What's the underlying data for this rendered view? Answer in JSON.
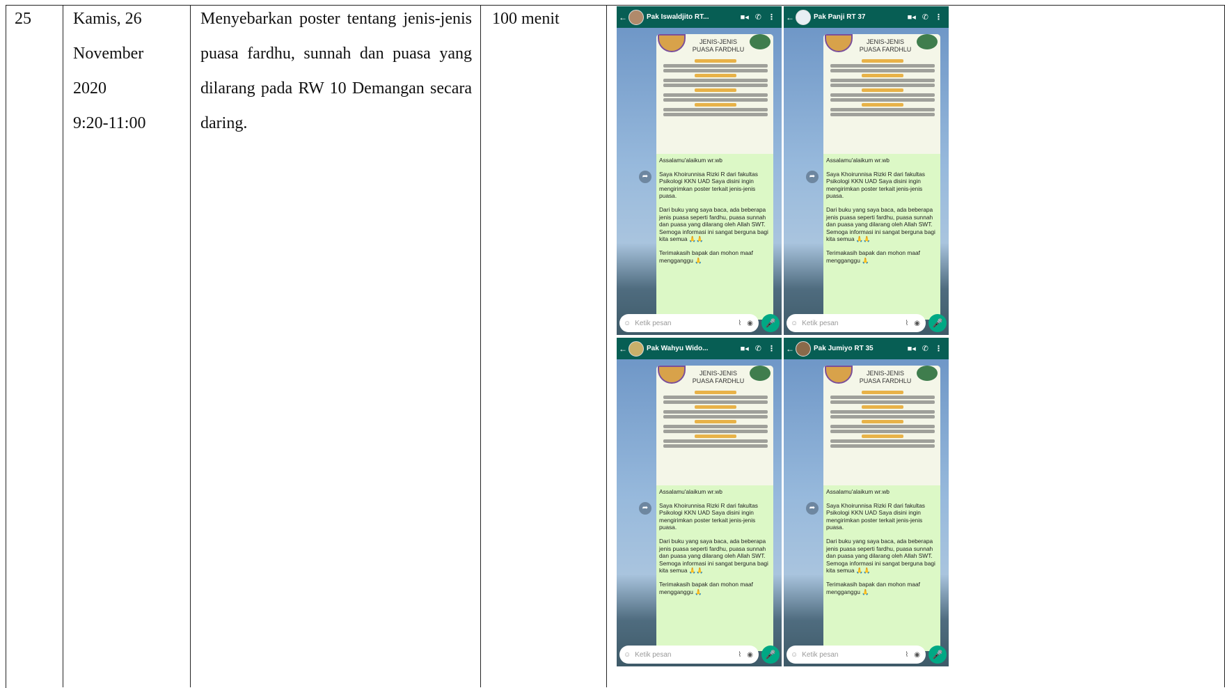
{
  "row": {
    "number": "25",
    "date_lines": [
      "Kamis, 26",
      "November",
      "2020",
      "9:20-11:00"
    ],
    "description": "Menyebarkan poster tentang jenis-jenis puasa fardhu, sunnah dan puasa yang dilarang pada RW 10 Demangan secara daring.",
    "duration": "100 menit"
  },
  "screenshots": [
    {
      "contact": "Pak Iswaldjito RT..."
    },
    {
      "contact": "Pak Panji RT 37"
    },
    {
      "contact": "Pak Wahyu Wido..."
    },
    {
      "contact": "Pak Jumiyo RT 35"
    }
  ],
  "chat": {
    "poster_title_1": "JENIS-JENIS",
    "poster_title_2": "PUASA FARDHLU",
    "greeting": "Assalamu'alaikum wr.wb",
    "para1": "Saya Khoirunnisa Rizki R dari fakultas Psikologi KKN UAD Saya disini ingin mengirimkan poster terkait jenis-jenis puasa.",
    "para2": "Dari buku yang saya baca, ada beberapa jenis puasa seperti fardhu, puasa sunnah dan puasa yang dilarang oleh Allah SWT. Semoga informasi ini sangat berguna bagi kita semua 🙏🙏",
    "para3": "Terimakasih bapak dan mohon maaf mengganggu 🙏",
    "input_placeholder": "Ketik pesan"
  }
}
